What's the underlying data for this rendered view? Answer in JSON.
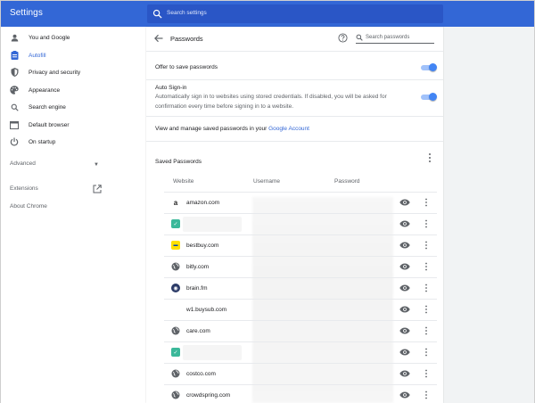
{
  "header": {
    "title": "Settings",
    "search_placeholder": "Search settings"
  },
  "sidebar": {
    "items": [
      {
        "label": "You and Google",
        "icon": "person-icon"
      },
      {
        "label": "Autofill",
        "icon": "clipboard-icon",
        "active": true
      },
      {
        "label": "Privacy and security",
        "icon": "shield-icon"
      },
      {
        "label": "Appearance",
        "icon": "palette-icon"
      },
      {
        "label": "Search engine",
        "icon": "search-icon"
      },
      {
        "label": "Default browser",
        "icon": "browser-icon"
      },
      {
        "label": "On startup",
        "icon": "power-icon"
      }
    ],
    "advanced": "Advanced",
    "extensions": "Extensions",
    "about": "About Chrome"
  },
  "page": {
    "title": "Passwords",
    "search_placeholder": "Search passwords",
    "offer_label": "Offer to save passwords",
    "autosignin_label": "Auto Sign-in",
    "autosignin_desc": "Automatically sign in to websites using stored credentials. If disabled, you will be asked for confirmation every time before signing in to a website.",
    "manage_text": "View and manage saved passwords in your ",
    "manage_link": "Google Account",
    "saved_title": "Saved Passwords",
    "columns": {
      "website": "Website",
      "username": "Username",
      "password": "Password"
    },
    "rows": [
      {
        "site": "amazon.com",
        "icon": "amazon-icon"
      },
      {
        "site": "",
        "icon": "green-square-icon"
      },
      {
        "site": "bestbuy.com",
        "icon": "bestbuy-icon"
      },
      {
        "site": "bitly.com",
        "icon": "globe-icon"
      },
      {
        "site": "brain.fm",
        "icon": "brainfm-icon"
      },
      {
        "site": "w1.buysub.com",
        "icon": ""
      },
      {
        "site": "care.com",
        "icon": "globe-icon"
      },
      {
        "site": "",
        "icon": "green-square-icon"
      },
      {
        "site": "costco.com",
        "icon": "globe-icon"
      },
      {
        "site": "crowdspring.com",
        "icon": "globe-icon"
      }
    ]
  },
  "colors": {
    "brand": "#3367d6",
    "toggle_on": "#4285f4"
  }
}
